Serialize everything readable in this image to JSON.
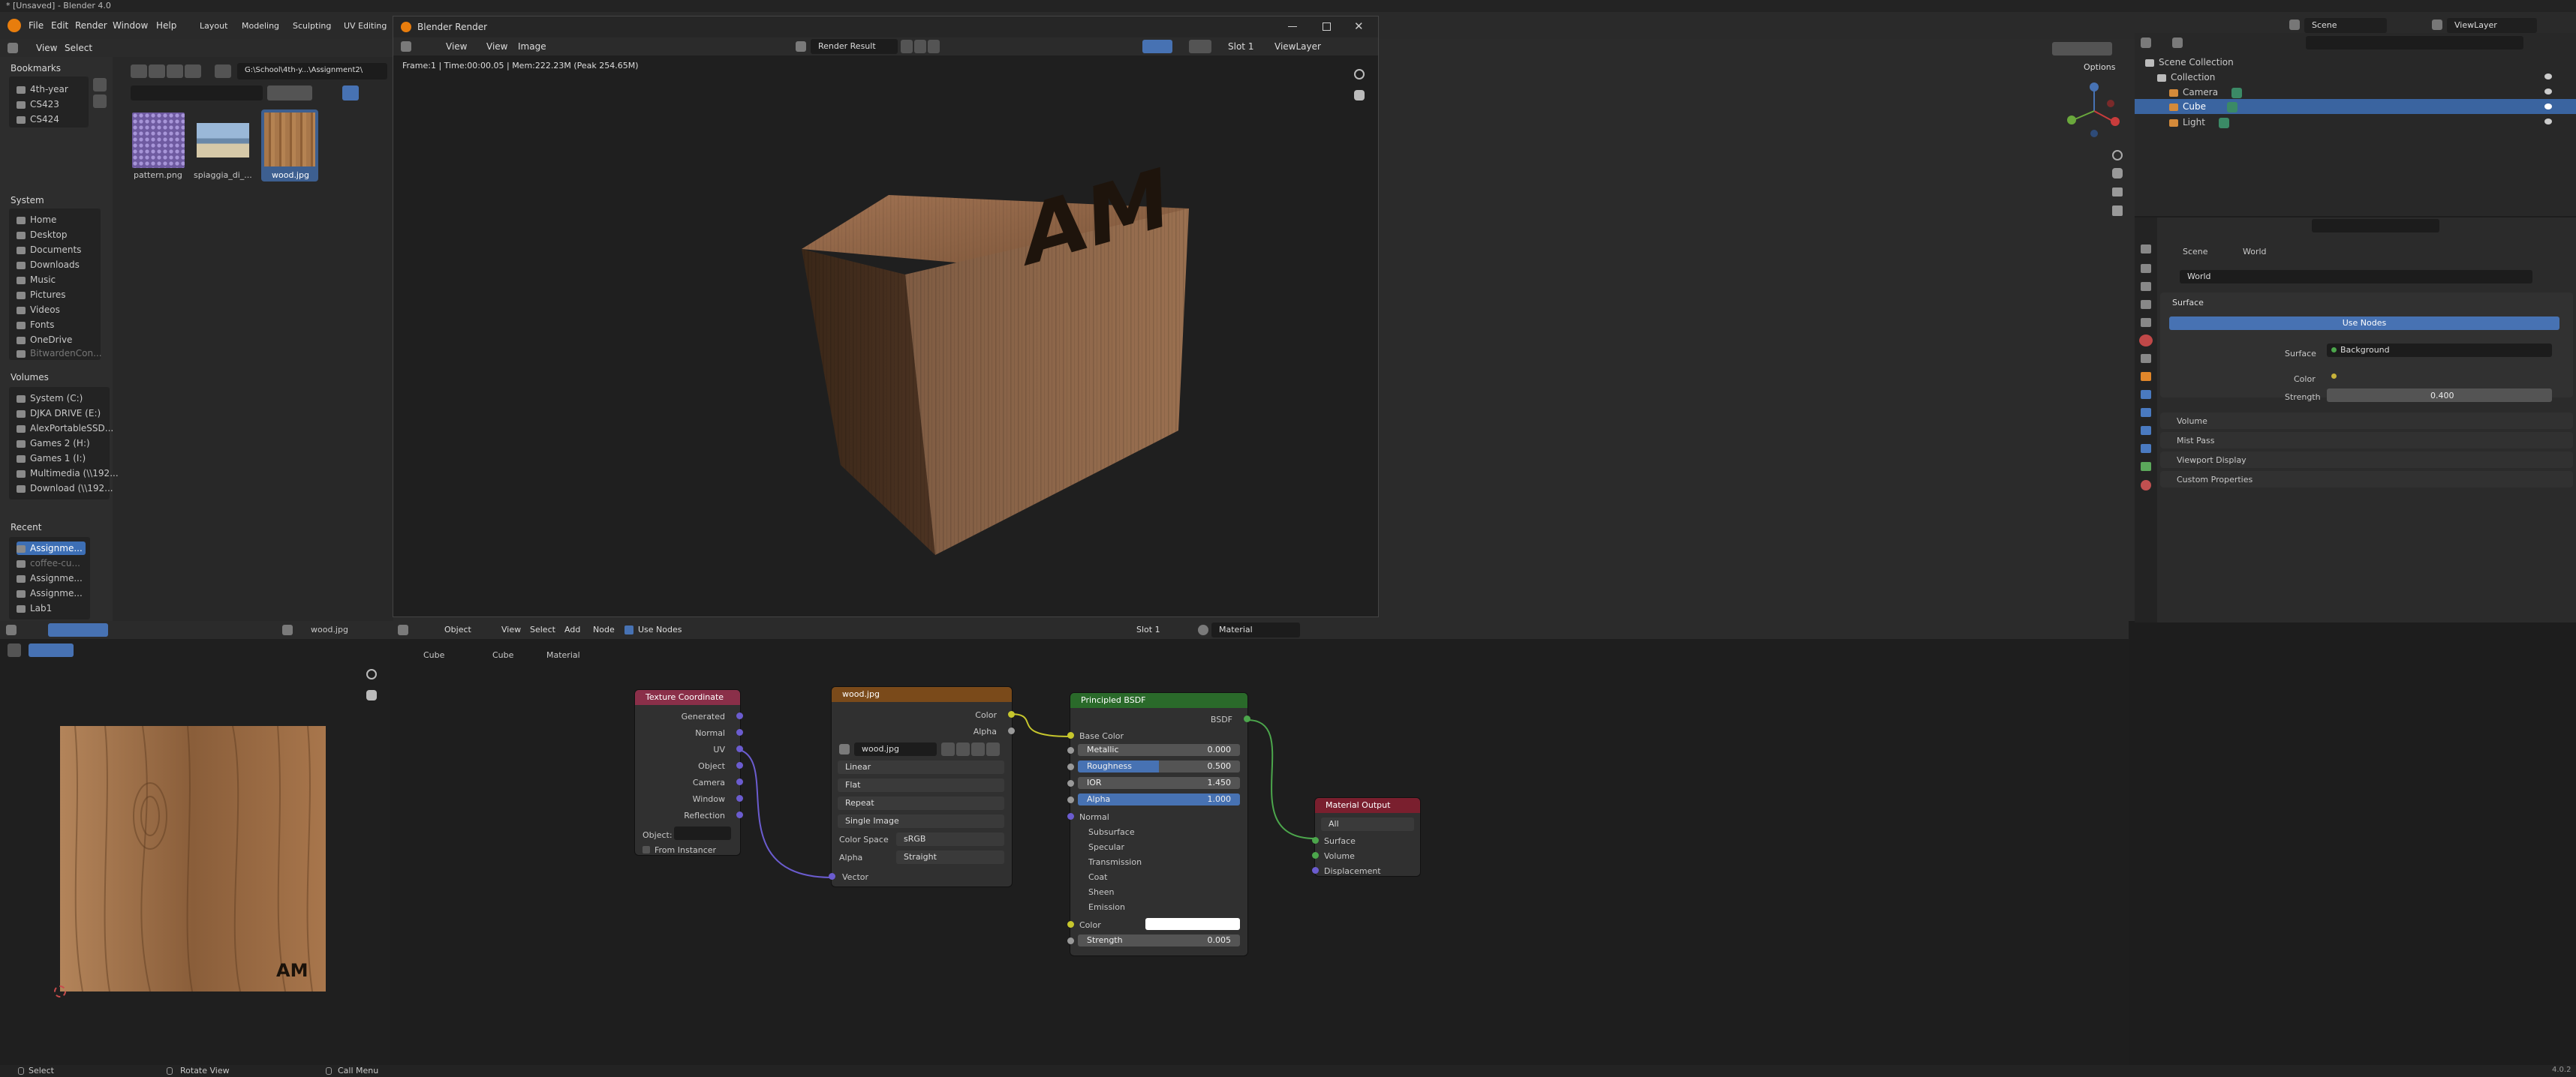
{
  "window_title": "* [Unsaved] - Blender 4.0",
  "topbar": {
    "menus": [
      "File",
      "Edit",
      "Render",
      "Window",
      "Help"
    ],
    "workspaces": [
      "Layout",
      "Modeling",
      "Sculpting",
      "UV Editing"
    ],
    "scene": "Scene",
    "viewlayer": "ViewLayer"
  },
  "filebrowser": {
    "menus": [
      "View",
      "Select"
    ],
    "path": "G:\\School\\4th-y...\\Assignment2\\",
    "bookmarks_title": "Bookmarks",
    "bookmarks": [
      "4th-year",
      "CS423",
      "CS424"
    ],
    "system_title": "System",
    "system": [
      "Home",
      "Desktop",
      "Documents",
      "Downloads",
      "Music",
      "Pictures",
      "Videos",
      "Fonts",
      "OneDrive",
      "BitwardenCon..."
    ],
    "volumes_title": "Volumes",
    "volumes": [
      "System (C:)",
      "DJKA DRIVE (E:)",
      "AlexPortableSSD...",
      "Games 2 (H:)",
      "Games 1 (I:)",
      "Multimedia (\\\\192...",
      "Download (\\\\192..."
    ],
    "recent_title": "Recent",
    "recent": [
      "Assignme...",
      "coffee-cu...",
      "Assignme...",
      "Assignme...",
      "Lab1"
    ],
    "files": [
      "pattern.png",
      "spiaggia_di_...",
      "wood.jpg"
    ]
  },
  "render_window": {
    "title": "Blender Render",
    "menus": [
      "View",
      "View",
      "Image"
    ],
    "image_name": "Render Result",
    "slot": "Slot 1",
    "layer": "ViewLayer",
    "status": "Frame:1 | Time:00:00.05 | Mem:222.23M (Peak 254.65M)",
    "cube_text": "AM"
  },
  "viewport": {
    "options": "Options"
  },
  "outliner": {
    "items": [
      "Scene Collection",
      "Collection",
      "Camera",
      "Cube",
      "Light"
    ]
  },
  "properties": {
    "breadcrumb": [
      "Scene",
      "World"
    ],
    "world_name": "World",
    "surface_title": "Surface",
    "use_nodes": "Use Nodes",
    "surface_label": "Surface",
    "surface_value": "Background",
    "color_label": "Color",
    "strength_label": "Strength",
    "strength_value": "0.400",
    "panels": [
      "Volume",
      "Mist Pass",
      "Viewport Display",
      "Custom Properties"
    ]
  },
  "image_editor": {
    "image_name": "wood.jpg",
    "texture_text": "AM"
  },
  "node_editor": {
    "header_menus": [
      "Object",
      "View",
      "Select",
      "Add",
      "Node"
    ],
    "use_nodes": "Use Nodes",
    "slot": "Slot 1",
    "material": "Material",
    "breadcrumb": [
      "Cube",
      "Cube",
      "Material"
    ],
    "texcoord": {
      "title": "Texture Coordinate",
      "outputs": [
        "Generated",
        "Normal",
        "UV",
        "Object",
        "Camera",
        "Window",
        "Reflection"
      ],
      "object_label": "Object:",
      "from_instancer": "From Instancer"
    },
    "image_tex": {
      "title": "wood.jpg",
      "outputs": [
        "Color",
        "Alpha"
      ],
      "image": "wood.jpg",
      "interpolation": "Linear",
      "projection": "Flat",
      "extension": "Repeat",
      "source": "Single Image",
      "colorspace_label": "Color Space",
      "colorspace": "sRGB",
      "alpha_label": "Alpha",
      "alpha": "Straight",
      "vector": "Vector"
    },
    "bsdf": {
      "title": "Principled BSDF",
      "output": "BSDF",
      "base_color": "Base Color",
      "sliders": [
        {
          "label": "Metallic",
          "value": "0.000",
          "fill": 0.0
        },
        {
          "label": "Roughness",
          "value": "0.500",
          "fill": 0.5
        },
        {
          "label": "IOR",
          "value": "1.450",
          "fill": 0.0
        },
        {
          "label": "Alpha",
          "value": "1.000",
          "fill": 1.0
        }
      ],
      "normal": "Normal",
      "subpanels": [
        "Subsurface",
        "Specular",
        "Transmission",
        "Coat",
        "Sheen"
      ],
      "emission": "Emission",
      "em_color": "Color",
      "em_strength_label": "Strength",
      "em_strength": "0.005"
    },
    "output": {
      "title": "Material Output",
      "target": "All",
      "inputs": [
        "Surface",
        "Volume",
        "Displacement"
      ]
    }
  },
  "statusbar": {
    "items": [
      "Select",
      "Rotate View",
      "Call Menu"
    ],
    "version": "4.0.2"
  },
  "colors": {
    "accent": "#4772b3",
    "texcoord_header": "#862f45",
    "image_header": "#7a4a1a",
    "bsdf_header": "#2a6a2a",
    "output_header": "#7a1f2e"
  }
}
